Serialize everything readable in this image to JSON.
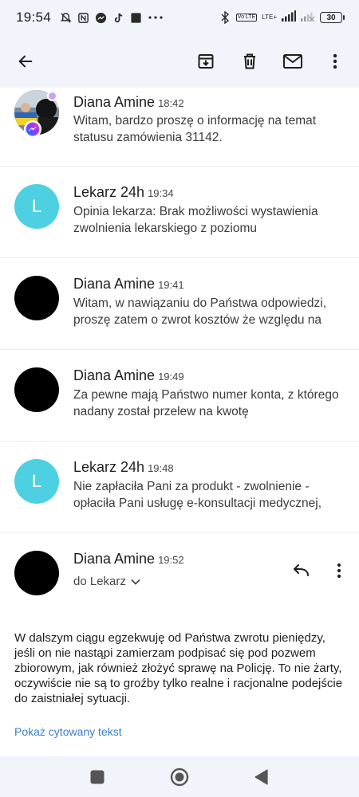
{
  "status_bar": {
    "time": "19:54",
    "left_icons": [
      "muted-bell-icon",
      "nfc-icon",
      "messenger-icon",
      "tiktok-icon",
      "square-icon",
      "more-dots-icon"
    ],
    "network_badge": "Vo LTE",
    "network_label": "LTE+",
    "battery": "30"
  },
  "toolbar": {
    "actions": [
      "back-arrow-icon",
      "archive-icon",
      "delete-icon",
      "mark-unread-icon",
      "more-vert-icon"
    ]
  },
  "thread": {
    "messages": [
      {
        "sender": "Diana Amine",
        "time": "18:42",
        "snippet": "Witam, bardzo proszę o informację na temat statusu zamówienia 31142.",
        "avatar": "photo"
      },
      {
        "sender": "Lekarz 24h",
        "time": "19:34",
        "snippet": "Opinia lekarza: Brak możliwości wystawienia zwolnienia lekarskiego z poziomu",
        "avatar": "L"
      },
      {
        "sender": "Diana Amine",
        "time": "19:41",
        "snippet": "Witam, w nawiązaniu do Państwa odpowiedzi, proszę zatem o zwrot kosztów że względu na",
        "avatar": "dark"
      },
      {
        "sender": "Diana Amine",
        "time": "19:49",
        "snippet": "Za pewne mają Państwo numer konta, z którego nadany został przelew na kwotę",
        "avatar": "dark"
      },
      {
        "sender": "Lekarz 24h",
        "time": "19:48",
        "snippet": "Nie zapłaciła Pani za produkt - zwolnienie - opłaciła Pani usługę e-konsultacji medycznej,",
        "avatar": "L"
      }
    ],
    "expanded": {
      "sender": "Diana Amine",
      "time": "19:52",
      "recipient": "do Lekarz",
      "body": "W dalszym ciągu egzekwuję od Państwa zwrotu pieniędzy, jeśli on nie nastąpi zamierzam podpisać się pod pozwem zbiorowym, jak również złożyć sprawę na Policję. To nie żarty, oczywiście nie są to groźby tylko realne i racjonalne podejście do zaistniałej sytuacji.",
      "show_quoted": "Pokaż cytowany tekst"
    }
  },
  "colors": {
    "chrome": "#f2f4fb",
    "avatar_letter_bg": "#4dd0e1",
    "link": "#3a80c9"
  },
  "nav_bar": {
    "buttons": [
      "recents-square-icon",
      "home-circle-icon",
      "back-triangle-icon"
    ]
  }
}
